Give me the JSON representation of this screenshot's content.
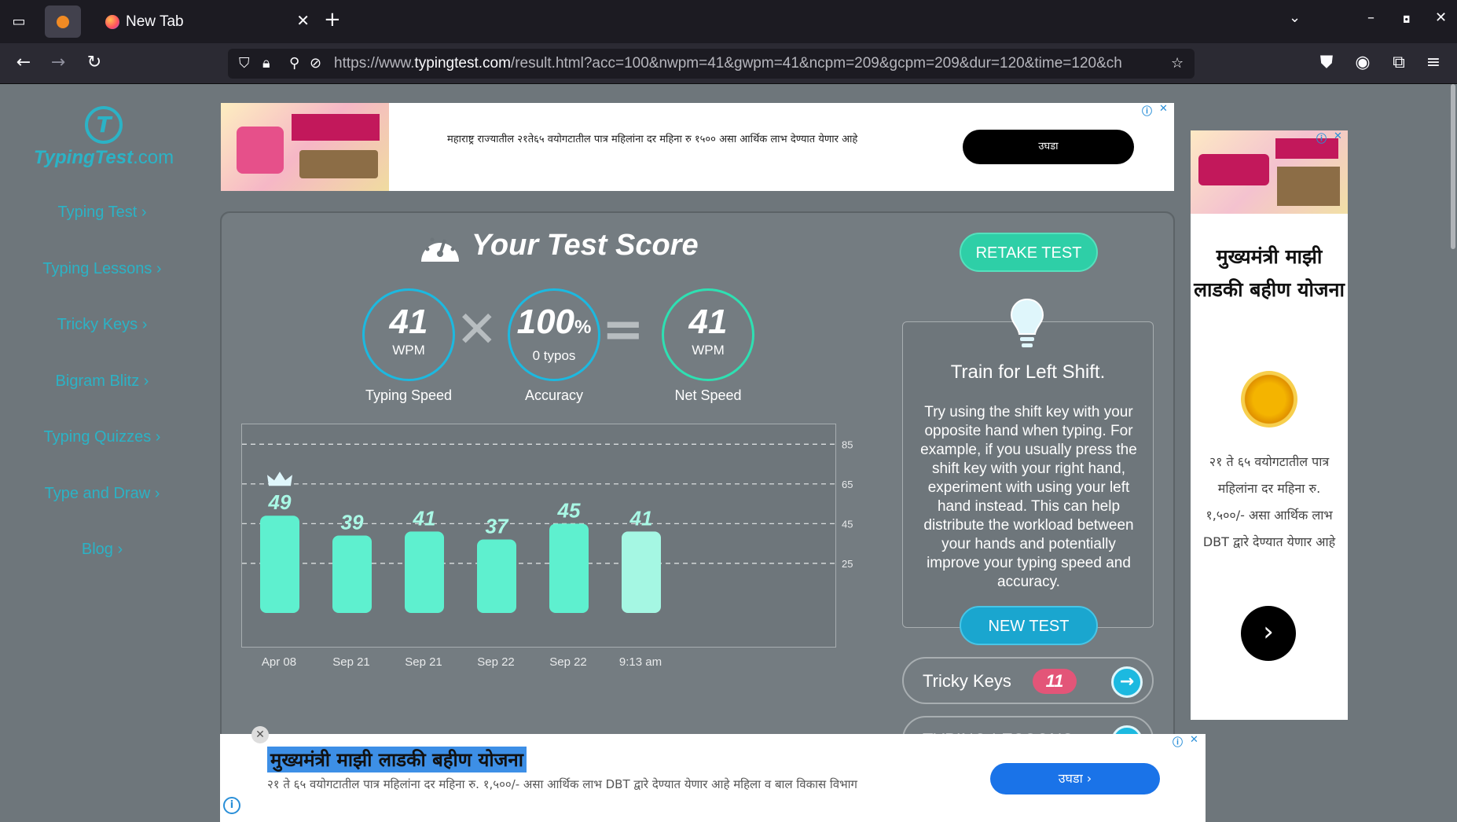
{
  "browser": {
    "tab_title": "New Tab",
    "url_prefix": "https://www.",
    "url_domain": "typingtest.com",
    "url_rest": "/result.html?acc=100&nwpm=41&gwpm=41&ncpm=209&gcpm=209&dur=120&time=120&ch"
  },
  "sidebar": {
    "logo_main": "TypingTest",
    "logo_suffix": ".com",
    "items": [
      {
        "label": "Typing Test ›"
      },
      {
        "label": "Typing Lessons ›"
      },
      {
        "label": "Tricky Keys ›"
      },
      {
        "label": "Bigram Blitz ›"
      },
      {
        "label": "Typing Quizzes ›"
      },
      {
        "label": "Type and Draw ›"
      },
      {
        "label": "Blog ›"
      }
    ]
  },
  "ad_top": {
    "text": "महाराष्ट्र राज्यातील २१ते६५ वयोगटातील पात्र महिलांना दर महिना रु १५०० असा आर्थिक लाभ देण्यात येणार आहे",
    "button": "उघडा"
  },
  "score": {
    "title": "Your Test Score",
    "retake": "RETAKE TEST",
    "typing_speed": {
      "value": "41",
      "unit": "WPM",
      "label": "Typing Speed"
    },
    "accuracy": {
      "value": "100",
      "unit": "%",
      "sub": "0 typos",
      "label": "Accuracy"
    },
    "net_speed": {
      "value": "41",
      "unit": "WPM",
      "label": "Net Speed"
    }
  },
  "chart_data": {
    "type": "bar",
    "categories": [
      "Apr 08",
      "Sep 21",
      "Sep 21",
      "Sep 22",
      "Sep 22",
      "9:13 am"
    ],
    "values": [
      49,
      39,
      41,
      37,
      45,
      41
    ],
    "yticks": [
      25,
      45,
      65,
      85
    ],
    "ylim": [
      0,
      95
    ],
    "grid": true,
    "best_marker": "crown-on-first-bar",
    "colors": {
      "bar": "#5ef0cf",
      "current_bar": "#a5f7e3",
      "label": "#a9f8e5"
    }
  },
  "tip": {
    "title": "Train for Left Shift.",
    "body": "Try using the shift key with your opposite hand when typing. For example, if you usually press the shift key with your right hand, experiment with using your left hand instead. This can help distribute the workload between your hands and potentially improve your typing speed and accuracy.",
    "button": "NEW TEST"
  },
  "tricky_keys": {
    "label": "Tricky Keys",
    "count": "11"
  },
  "typing_lessons": {
    "label": "TYPING LESSONS"
  },
  "ad_right": {
    "heading": "मुख्यमंत्री माझी लाडकी बहीण योजना",
    "body": "२१ ते ६५ वयोगटातील पात्र महिलांना दर महिना रु. १,५००/- असा आर्थिक लाभ DBT द्वारे देण्यात येणार आहे",
    "go": "›"
  },
  "ad_bottom": {
    "headline": "मुख्यमंत्री माझी लाडकी बहीण योजना",
    "body": "२१ ते ६५ वयोगटातील पात्र महिलांना दर महिना रु. १,५००/- असा आर्थिक लाभ DBT द्वारे देण्यात येणार आहे महिला व बाल विकास विभाग",
    "button": "उघडा  ›"
  }
}
